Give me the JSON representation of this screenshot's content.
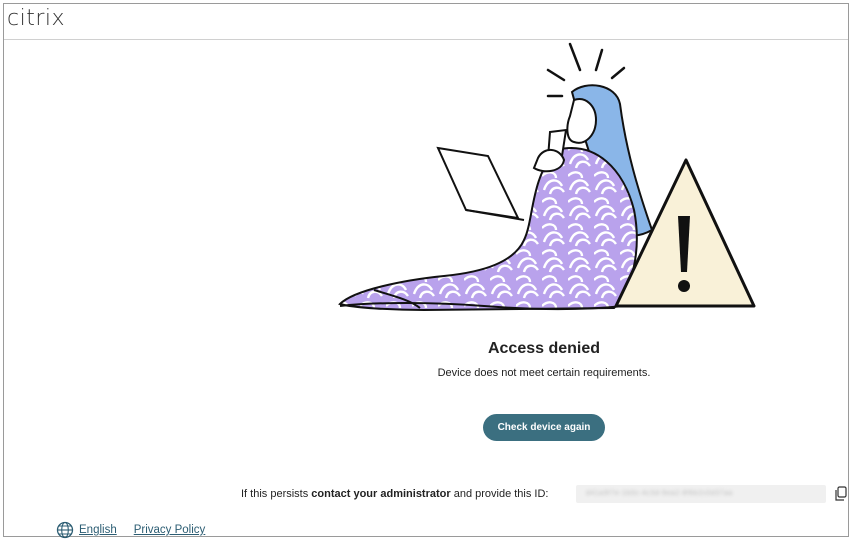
{
  "header": {
    "logo_text": "citri",
    "logo_text_dot_x": "x"
  },
  "main": {
    "title": "Access denied",
    "subtitle": "Device does not meet certain requirements.",
    "check_button_label": "Check device again",
    "persist_prefix": "If this persists ",
    "persist_bold": "contact your administrator",
    "persist_suffix": " and provide this ID:",
    "device_id_redacted": "d41a9f7e-1b0c-4c3d-9ea2-8f6b2c0d37aa"
  },
  "footer": {
    "language_label": "English",
    "privacy_label": "Privacy Policy"
  },
  "colors": {
    "accent": "#3b6f80",
    "link": "#2c5d73",
    "warning_fill": "#f9f1d8",
    "dress": "#b9a2ec",
    "hair": "#8ab6e8"
  },
  "icons": [
    "globe-icon",
    "copy-icon",
    "warning-triangle-icon"
  ]
}
